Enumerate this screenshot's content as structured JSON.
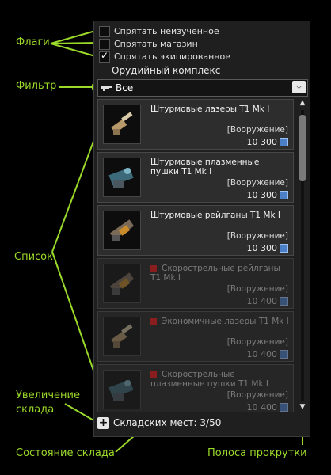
{
  "annotations": {
    "flags": "Флаги",
    "filter": "Фильтр",
    "list": "Список",
    "storage_increase_line1": "Увеличение",
    "storage_increase_line2": "склада",
    "storage_state": "Состояние склада",
    "scrollbar": "Полоса прокрутки"
  },
  "checkboxes": [
    {
      "label": "Спрятать неизученное",
      "checked": false
    },
    {
      "label": "Спрятать магазин",
      "checked": false
    },
    {
      "label": "Спрятать экипированное",
      "checked": true
    }
  ],
  "section_title": "Орудийный комплекс",
  "filter": {
    "value": "Все",
    "icon": "gun-icon",
    "dropdown_icon": "chevron-down-icon"
  },
  "items": [
    {
      "name": "Штурмовые лазеры T1 Mk I",
      "category": "[Вооружение]",
      "price": "10 300",
      "locked": false
    },
    {
      "name": "Штурмовые плазменные пушки T1 Mk I",
      "category": "[Вооружение]",
      "price": "10 300",
      "locked": false
    },
    {
      "name": "Штурмовые рейлганы T1 Mk I",
      "category": "[Вооружение]",
      "price": "10 300",
      "locked": false
    },
    {
      "name": "Скорострельные рейлганы T1 Mk I",
      "category": "[Вооружение]",
      "price": "10 400",
      "locked": true
    },
    {
      "name": "Экономичные лазеры T1 Mk I",
      "category": "[Вооружение]",
      "price": "10 400",
      "locked": true
    },
    {
      "name": "Скорострельные плазменные пушки T1 Mk I",
      "category": "[Вооружение]",
      "price": "10 400",
      "locked": true
    }
  ],
  "storage": {
    "text": "Складских мест: 3/50",
    "button_icon": "plus-icon"
  },
  "colors": {
    "annotation": "#9bd92a",
    "currency": "#4b7fc8",
    "lock": "#8a1d1d"
  }
}
